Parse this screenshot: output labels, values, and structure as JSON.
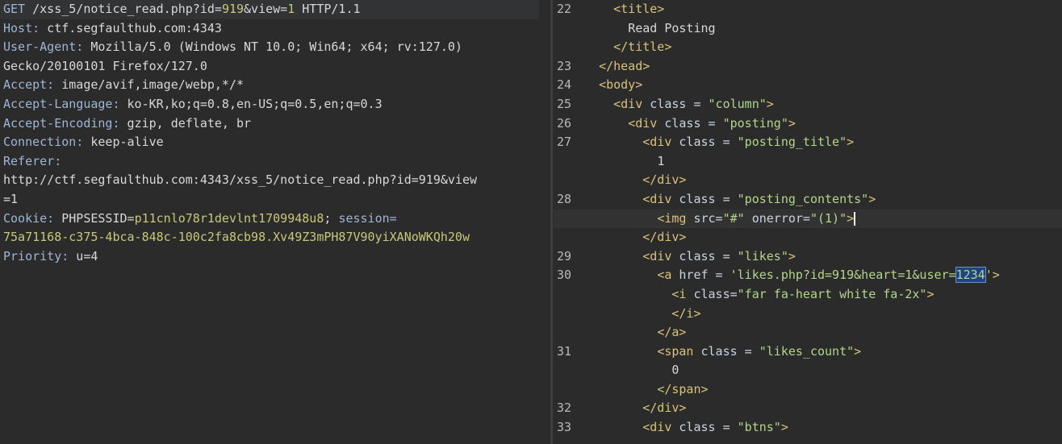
{
  "request": {
    "method": "GET",
    "path_prefix": "/xss_5/notice_read.php?id=",
    "id_value": "919",
    "mid1": "&view=",
    "view_value": "1",
    "protocol": " HTTP/1.1",
    "host_key": "Host:",
    "host_val": " ctf.segfaulthub.com:4343",
    "ua_key": "User-Agent:",
    "ua_val": " Mozilla/5.0 (Windows NT 10.0; Win64; x64; rv:127.0)",
    "ua_cont": "Gecko/20100101 Firefox/127.0",
    "accept_key": "Accept:",
    "accept_val": " image/avif,image/webp,*/*",
    "al_key": "Accept-Language:",
    "al_val": " ko-KR,ko;q=0.8,en-US;q=0.5,en;q=0.3",
    "ae_key": "Accept-Encoding:",
    "ae_val": " gzip, deflate, br",
    "conn_key": "Connection:",
    "conn_val": " keep-alive",
    "ref_key": "Referer:",
    "ref_val1": "http://ctf.segfaulthub.com:4343/xss_5/notice_read.php?id=919&view",
    "ref_val2": "=1",
    "cookie_key": "Cookie:",
    "cookie_name1": " PHPSESSID=",
    "cookie_val1": "p11cnlo78r1devlnt1709948u8",
    "cookie_sep": "; ",
    "cookie_name2": "session=",
    "cookie_val2": "75a71168-c375-4bca-848c-100c2fa8cb98.Xv49Z3mPH87V90yiXANoWKQh20w",
    "prio_key": "Priority:",
    "prio_val": " u=4"
  },
  "response": {
    "lines": [
      {
        "num": "22",
        "indent": "    ",
        "parts": [
          [
            "tag",
            "<title>"
          ]
        ]
      },
      {
        "num": "",
        "indent": "      ",
        "parts": [
          [
            "text",
            "Read Posting"
          ]
        ]
      },
      {
        "num": "",
        "indent": "    ",
        "parts": [
          [
            "tag",
            "</title>"
          ]
        ]
      },
      {
        "num": "23",
        "indent": "  ",
        "parts": [
          [
            "tag",
            "</head>"
          ]
        ]
      },
      {
        "num": "24",
        "indent": "  ",
        "parts": [
          [
            "tag",
            "<body>"
          ]
        ]
      },
      {
        "num": "25",
        "indent": "    ",
        "parts": [
          [
            "tag",
            "<div "
          ],
          [
            "attr",
            "class = "
          ],
          [
            "str",
            "\"column\""
          ],
          [
            "tag",
            ">"
          ]
        ]
      },
      {
        "num": "26",
        "indent": "      ",
        "parts": [
          [
            "tag",
            "<div "
          ],
          [
            "attr",
            "class = "
          ],
          [
            "str",
            "\"posting\""
          ],
          [
            "tag",
            ">"
          ]
        ]
      },
      {
        "num": "27",
        "indent": "        ",
        "parts": [
          [
            "tag",
            "<div "
          ],
          [
            "attr",
            "class = "
          ],
          [
            "str",
            "\"posting_title\""
          ],
          [
            "tag",
            ">"
          ]
        ]
      },
      {
        "num": "",
        "indent": "          ",
        "parts": [
          [
            "text",
            "1"
          ]
        ]
      },
      {
        "num": "",
        "indent": "        ",
        "parts": [
          [
            "tag",
            "</div>"
          ]
        ]
      },
      {
        "num": "28",
        "indent": "        ",
        "parts": [
          [
            "tag",
            "<div "
          ],
          [
            "attr",
            "class = "
          ],
          [
            "str",
            "\"posting_contents\""
          ],
          [
            "tag",
            ">"
          ]
        ]
      },
      {
        "num": "",
        "indent": "          ",
        "current": true,
        "parts": [
          [
            "tag",
            "<img "
          ],
          [
            "attr",
            "src="
          ],
          [
            "str",
            "\"#\""
          ],
          [
            "attr",
            " onerror="
          ],
          [
            "str",
            "\"(1)\""
          ],
          [
            "tag",
            ">"
          ],
          [
            "caret",
            ""
          ]
        ]
      },
      {
        "num": "",
        "indent": "        ",
        "parts": [
          [
            "tag",
            "</div>"
          ]
        ]
      },
      {
        "num": "29",
        "indent": "        ",
        "parts": [
          [
            "tag",
            "<div "
          ],
          [
            "attr",
            "class = "
          ],
          [
            "str",
            "\"likes\""
          ],
          [
            "tag",
            ">"
          ]
        ]
      },
      {
        "num": "30",
        "indent": "          ",
        "parts": [
          [
            "tag",
            "<a "
          ],
          [
            "attr",
            "href = "
          ],
          [
            "str",
            "'likes.php?id=919&heart=1&user="
          ],
          [
            "sel",
            "1234"
          ],
          [
            "str",
            "'"
          ],
          [
            "tag",
            ">"
          ]
        ]
      },
      {
        "num": "",
        "indent": "            ",
        "parts": [
          [
            "tag",
            "<i "
          ],
          [
            "attr",
            "class="
          ],
          [
            "str",
            "\"far fa-heart white fa-2x\""
          ],
          [
            "tag",
            ">"
          ]
        ]
      },
      {
        "num": "",
        "indent": "            ",
        "parts": [
          [
            "tag",
            "</i>"
          ]
        ]
      },
      {
        "num": "",
        "indent": "          ",
        "parts": [
          [
            "tag",
            "</a>"
          ]
        ]
      },
      {
        "num": "31",
        "indent": "          ",
        "parts": [
          [
            "tag",
            "<span "
          ],
          [
            "attr",
            "class = "
          ],
          [
            "str",
            "\"likes_count\""
          ],
          [
            "tag",
            ">"
          ]
        ]
      },
      {
        "num": "",
        "indent": "            ",
        "parts": [
          [
            "text",
            "0"
          ]
        ]
      },
      {
        "num": "",
        "indent": "          ",
        "parts": [
          [
            "tag",
            "</span>"
          ]
        ]
      },
      {
        "num": "32",
        "indent": "        ",
        "parts": [
          [
            "tag",
            "</div>"
          ]
        ]
      },
      {
        "num": "33",
        "indent": "        ",
        "parts": [
          [
            "tag",
            "<div "
          ],
          [
            "attr",
            "class = "
          ],
          [
            "str",
            "\"btns\""
          ],
          [
            "tag",
            ">"
          ]
        ]
      }
    ]
  }
}
